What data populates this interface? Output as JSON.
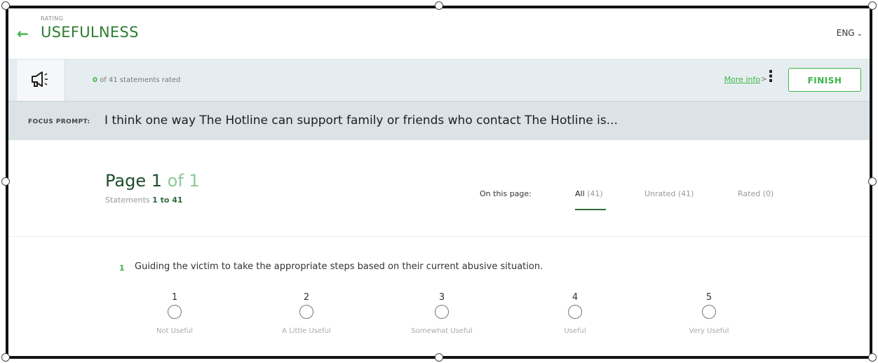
{
  "header": {
    "rating_label": "RATING",
    "title": "USEFULNESS",
    "language": "ENG"
  },
  "status": {
    "rated_count": "0",
    "rated_suffix": " of 41 statements rated",
    "more_info": "More info",
    "more_info_chevron": ">",
    "finish": "FINISH"
  },
  "focus": {
    "label": "FOCUS PROMPT:",
    "text": "I think one way The Hotline can support family or friends who contact The Hotline is..."
  },
  "page": {
    "page_word": "Page",
    "page_num": "1",
    "page_of": "of 1",
    "statements_label": "Statements",
    "range": "1 to 41",
    "on_this_page": "On this page:",
    "tabs": [
      {
        "label": "All",
        "count": "(41)"
      },
      {
        "label": "Unrated (41)"
      },
      {
        "label": "Rated (0)"
      }
    ]
  },
  "statement": {
    "number": "1",
    "text": "Guiding the victim to take the appropriate steps based on their current abusive situation.",
    "options": [
      {
        "value": "1",
        "label": "Not Useful"
      },
      {
        "value": "2",
        "label": "A Little Useful"
      },
      {
        "value": "3",
        "label": "Somewhat Useful"
      },
      {
        "value": "4",
        "label": "Useful"
      },
      {
        "value": "5",
        "label": "Very Useful"
      }
    ]
  },
  "icons": {
    "back": "back-arrow-icon",
    "megaphone": "megaphone-icon",
    "kebab": "kebab-menu-icon",
    "chevron": "chevron-down-icon"
  },
  "colors": {
    "accent": "#3cb54a",
    "title": "#2e7d32",
    "bar": "#e6edf0",
    "focus_bg": "#dbe3e6"
  }
}
